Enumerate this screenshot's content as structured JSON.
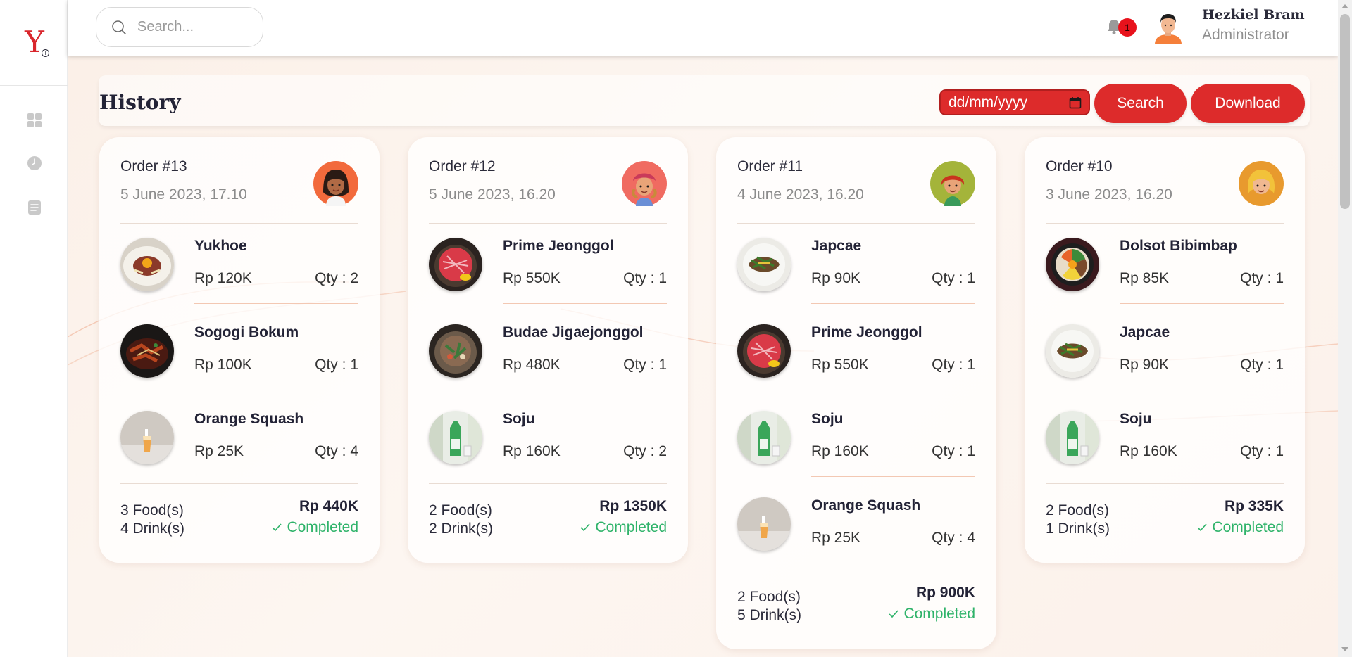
{
  "app": {
    "logo_letter": "Y",
    "brand_color": "#dd2b2b"
  },
  "sidebar": {
    "items": [
      {
        "icon": "dashboard-grid-icon"
      },
      {
        "icon": "history-clock-icon"
      },
      {
        "icon": "document-list-icon"
      }
    ]
  },
  "topbar": {
    "search_placeholder": "Search...",
    "notification_count": "1",
    "user_name": "Hezkiel Bram",
    "user_role": "Administrator"
  },
  "page": {
    "title": "History",
    "date_placeholder": "dd/mm/yyyy",
    "search_label": "Search",
    "download_label": "Download"
  },
  "orders": [
    {
      "order_no": "Order #13",
      "date": "5 June 2023, 17.10",
      "avatar_color": "#f26a3c",
      "items": [
        {
          "name": "Yukhoe",
          "price": "Rp 120K",
          "qty": "Qty : 2"
        },
        {
          "name": "Sogogi Bokum",
          "price": "Rp 100K",
          "qty": "Qty : 1"
        },
        {
          "name": "Orange Squash",
          "price": "Rp 25K",
          "qty": "Qty : 4"
        }
      ],
      "food_count": "3 Food(s)",
      "drink_count": "4 Drink(s)",
      "total": "Rp 440K",
      "status": "Completed"
    },
    {
      "order_no": "Order #12",
      "date": "5 June 2023, 16.20",
      "avatar_color": "#f06b61",
      "items": [
        {
          "name": "Prime Jeonggol",
          "price": "Rp 550K",
          "qty": "Qty : 1"
        },
        {
          "name": "Budae Jigaejonggol",
          "price": "Rp 480K",
          "qty": "Qty : 1"
        },
        {
          "name": "Soju",
          "price": "Rp 160K",
          "qty": "Qty : 2"
        }
      ],
      "food_count": "2 Food(s)",
      "drink_count": "2 Drink(s)",
      "total": "Rp 1350K",
      "status": "Completed"
    },
    {
      "order_no": "Order #11",
      "date": "4 June 2023, 16.20",
      "avatar_color": "#a4b43a",
      "items": [
        {
          "name": "Japcae",
          "price": "Rp 90K",
          "qty": "Qty : 1"
        },
        {
          "name": "Prime Jeonggol",
          "price": "Rp 550K",
          "qty": "Qty : 1"
        },
        {
          "name": "Soju",
          "price": "Rp 160K",
          "qty": "Qty : 1"
        },
        {
          "name": "Orange Squash",
          "price": "Rp 25K",
          "qty": "Qty : 4"
        }
      ],
      "food_count": "2 Food(s)",
      "drink_count": "5 Drink(s)",
      "total": "Rp 900K",
      "status": "Completed"
    },
    {
      "order_no": "Order #10",
      "date": "3 June 2023, 16.20",
      "avatar_color": "#e89a2e",
      "items": [
        {
          "name": "Dolsot Bibimbap",
          "price": "Rp 85K",
          "qty": "Qty : 1"
        },
        {
          "name": "Japcae",
          "price": "Rp 90K",
          "qty": "Qty : 1"
        },
        {
          "name": "Soju",
          "price": "Rp 160K",
          "qty": "Qty : 1"
        }
      ],
      "food_count": "2 Food(s)",
      "drink_count": "1 Drink(s)",
      "total": "Rp 335K",
      "status": "Completed"
    }
  ]
}
